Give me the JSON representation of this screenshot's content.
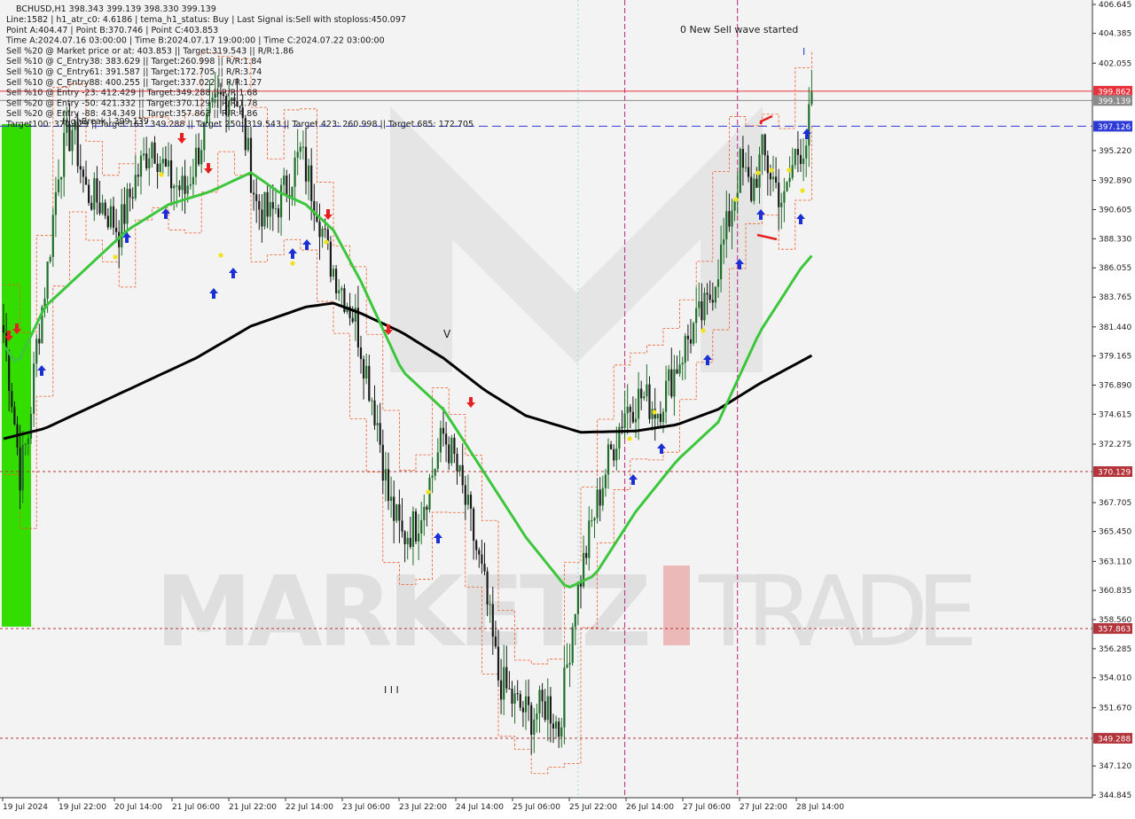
{
  "header": {
    "symbol_line": "BCHUSD,H1  398.343 399.139 398.330 399.139",
    "info_lines": [
      "Line:1582 | h1_atr_c0: 4.6186 | tema_h1_status: Buy | Last Signal is:Sell with stoploss:450.097",
      "Point A:404.47 | Point B:370.746 | Point C:403.853",
      "Time A:2024.07.16 03:00:00 | Time B:2024.07.17 19:00:00 | Time C:2024.07.22 03:00:00",
      "Sell %20 @ Market price or at: 403.853 || Target:319.543 || R/R:1.86",
      "Sell %10 @ C_Entry38: 383.629 || Target:260.998 || R/R:1.84",
      "Sell %10 @ C_Entry61: 391.587 || Target:172.705 || R/R:3.74",
      "Sell %10 @ C_Entry88: 400.255 || Target:337.022 || R/R:1.27",
      "Sell %10 @ Entry -23: 412.429 || Target:349.288 || R/R:1.68",
      "Sell %20 @ Entry -50: 421.332 || Target:370.129 || R/R:1.78",
      "Sell %20 @ Entry -88: 434.349 || Target:357.863 || R/R:4.86",
      "Target100: 370.129 || Target 161: 349.288 || Target 250: 319.543 || Target 423: 260.998 || Target 685: 172.705"
    ],
    "high_break_label": "HighBreak | 399.139"
  },
  "annotations": {
    "wave_text": "0 New Sell wave started",
    "wave_i": "I",
    "v_mark": "V",
    "iii_mark": "I I I"
  },
  "watermark": {
    "part1": "MARKETZ",
    "part2": "TRADE"
  },
  "chart_data": {
    "type": "candlestick",
    "symbol": "BCHUSD",
    "timeframe": "H1",
    "ylim": [
      344.845,
      406.645
    ],
    "y_ticks": [
      "406.645",
      "404.385",
      "402.055",
      "399.862",
      "399.139",
      "397.126",
      "395.220",
      "392.890",
      "390.605",
      "388.330",
      "386.055",
      "383.765",
      "381.440",
      "379.165",
      "376.890",
      "374.615",
      "372.275",
      "370.129",
      "367.705",
      "365.450",
      "363.110",
      "360.835",
      "358.560",
      "357.863",
      "356.285",
      "354.010",
      "351.670",
      "349.288",
      "347.120",
      "344.845"
    ],
    "x_ticks": [
      "19 Jul 2024",
      "19 Jul 22:00",
      "20 Jul 14:00",
      "21 Jul 06:00",
      "21 Jul 22:00",
      "22 Jul 14:00",
      "23 Jul 06:00",
      "23 Jul 22:00",
      "24 Jul 14:00",
      "25 Jul 06:00",
      "25 Jul 22:00",
      "26 Jul 14:00",
      "27 Jul 06:00",
      "27 Jul 22:00",
      "28 Jul 14:00"
    ],
    "horizontal_lines": [
      {
        "value": 399.862,
        "color": "#e8323c",
        "style": "solid",
        "label": "399.862"
      },
      {
        "value": 399.139,
        "color": "#8b8b8b",
        "style": "solid",
        "label": "399.139"
      },
      {
        "value": 397.126,
        "color": "#2e3ad6",
        "style": "dashed",
        "label": "397.126"
      },
      {
        "value": 370.129,
        "color": "#b3343a",
        "style": "dotted",
        "label": "370.129"
      },
      {
        "value": 357.863,
        "color": "#b3343a",
        "style": "dotted",
        "label": "357.863"
      },
      {
        "value": 349.288,
        "color": "#b3343a",
        "style": "dotted",
        "label": "349.288"
      }
    ],
    "anchor_closes": [
      [
        0,
        381
      ],
      [
        3,
        376
      ],
      [
        6,
        370
      ],
      [
        9,
        373
      ],
      [
        12,
        380
      ],
      [
        16,
        386
      ],
      [
        20,
        394
      ],
      [
        25,
        397
      ],
      [
        30,
        392
      ],
      [
        36,
        391
      ],
      [
        42,
        389
      ],
      [
        48,
        393
      ],
      [
        54,
        396
      ],
      [
        60,
        393
      ],
      [
        66,
        392
      ],
      [
        72,
        396
      ],
      [
        78,
        399
      ],
      [
        84,
        400
      ],
      [
        88,
        396
      ],
      [
        92,
        391
      ],
      [
        97,
        390
      ],
      [
        102,
        392
      ],
      [
        108,
        395
      ],
      [
        114,
        391
      ],
      [
        118,
        387
      ],
      [
        124,
        384
      ],
      [
        128,
        382
      ],
      [
        132,
        378
      ],
      [
        136,
        374
      ],
      [
        140,
        368
      ],
      [
        145,
        365
      ],
      [
        150,
        366
      ],
      [
        156,
        370
      ],
      [
        160,
        373
      ],
      [
        164,
        371
      ],
      [
        170,
        366
      ],
      [
        175,
        361
      ],
      [
        180,
        354
      ],
      [
        186,
        352
      ],
      [
        192,
        351
      ],
      [
        198,
        352
      ],
      [
        202,
        350
      ],
      [
        205,
        355
      ],
      [
        208,
        360
      ],
      [
        214,
        366
      ],
      [
        220,
        371
      ],
      [
        226,
        375
      ],
      [
        232,
        376
      ],
      [
        238,
        375
      ],
      [
        244,
        378
      ],
      [
        250,
        381
      ],
      [
        256,
        383
      ],
      [
        262,
        388
      ],
      [
        268,
        394
      ],
      [
        272,
        392
      ],
      [
        276,
        395
      ],
      [
        280,
        393
      ],
      [
        284,
        391
      ],
      [
        288,
        395
      ],
      [
        292,
        396
      ],
      [
        294,
        399
      ]
    ],
    "sma_green": [
      [
        0,
        380
      ],
      [
        5,
        378.5
      ],
      [
        15,
        383
      ],
      [
        30,
        386
      ],
      [
        45,
        389
      ],
      [
        60,
        391
      ],
      [
        75,
        392
      ],
      [
        90,
        393.5
      ],
      [
        100,
        392
      ],
      [
        110,
        391
      ],
      [
        120,
        389
      ],
      [
        130,
        385
      ],
      [
        145,
        378
      ],
      [
        160,
        375
      ],
      [
        175,
        370
      ],
      [
        190,
        365
      ],
      [
        205,
        361
      ],
      [
        215,
        362
      ],
      [
        230,
        367
      ],
      [
        245,
        371
      ],
      [
        260,
        374
      ],
      [
        275,
        381
      ],
      [
        290,
        386
      ],
      [
        294,
        387
      ]
    ],
    "sma_black": [
      [
        0,
        372.7
      ],
      [
        15,
        373.5
      ],
      [
        30,
        375
      ],
      [
        50,
        377
      ],
      [
        70,
        379
      ],
      [
        90,
        381.5
      ],
      [
        110,
        383
      ],
      [
        120,
        383.3
      ],
      [
        130,
        382.5
      ],
      [
        145,
        381
      ],
      [
        160,
        379
      ],
      [
        175,
        376.5
      ],
      [
        190,
        374.5
      ],
      [
        210,
        373.2
      ],
      [
        230,
        373.3
      ],
      [
        245,
        373.8
      ],
      [
        260,
        375
      ],
      [
        275,
        377
      ],
      [
        294,
        379.2
      ]
    ],
    "vertical_lines": [
      {
        "index": 209,
        "color": "#a0d8d8",
        "style": "dotted"
      },
      {
        "index": 226,
        "color": "#b8287a",
        "style": "dashed"
      },
      {
        "index": 267,
        "color": "#b8287a",
        "style": "dashed"
      }
    ]
  },
  "colors": {
    "background": "#ffffff",
    "plot_bg": "#f5f5f5",
    "bull": "#1f6e2a",
    "bear": "#1a1a1a",
    "green_band": "#33cc00",
    "envelope": "#f05a28",
    "arrow_up": "#1a2fd6",
    "arrow_down": "#e62020",
    "star": "#f2e21a"
  }
}
